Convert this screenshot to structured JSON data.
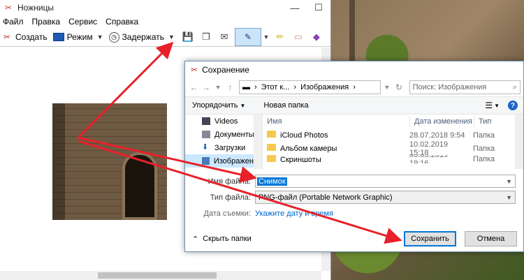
{
  "snip": {
    "title": "Ножницы",
    "window_min": "—",
    "window_max": "☐",
    "menu": [
      "Файл",
      "Правка",
      "Сервис",
      "Справка"
    ],
    "toolbar": {
      "create": "Создать",
      "mode": "Режим",
      "delay": "Задержать"
    }
  },
  "dialog": {
    "title": "Сохранение",
    "breadcrumb": [
      "Этот к...",
      "Изображения"
    ],
    "search_placeholder": "Поиск: Изображения",
    "organize": "Упорядочить",
    "new_folder": "Новая папка",
    "nav": [
      "Videos",
      "Документы",
      "Загрузки",
      "Изображения"
    ],
    "columns": [
      "Имя",
      "Дата изменения",
      "Тип"
    ],
    "files": [
      {
        "name": "iCloud Photos",
        "date": "28.07.2018 9:54",
        "type": "Папка"
      },
      {
        "name": "Альбом камеры",
        "date": "10.02.2019 15:18",
        "type": "Папка"
      },
      {
        "name": "Скриншоты",
        "date": "03.05.2019 19:16",
        "type": "Папка"
      }
    ],
    "filename_label": "Имя файла:",
    "filename_value": "Снимок",
    "filetype_label": "Тип файла:",
    "filetype_value": "PNG-файл (Portable Network Graphic)",
    "date_label": "Дата съемки:",
    "date_link": "Укажите дату и время",
    "hide_folders": "Скрыть папки",
    "save": "Сохранить",
    "cancel": "Отмена"
  },
  "colors": {
    "accent": "#0078d7",
    "arrow": "#e8202a",
    "selection": "#cce8ff"
  }
}
